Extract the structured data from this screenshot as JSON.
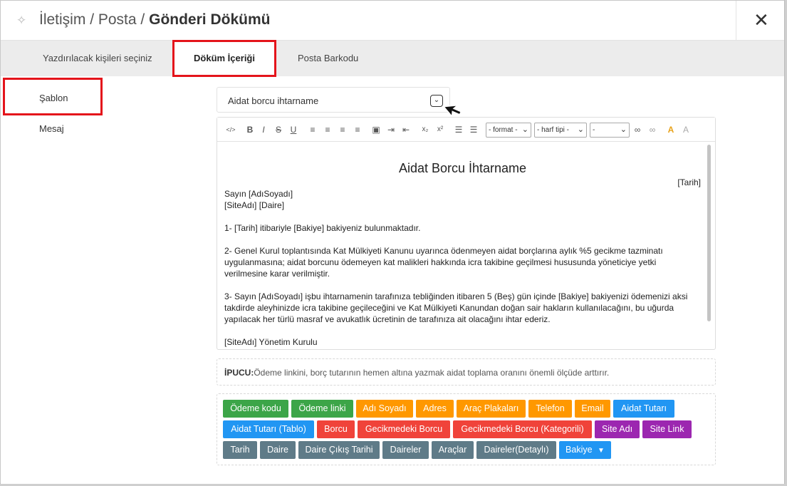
{
  "header": {
    "breadcrumb_1": "İletişim",
    "sep_1": "/",
    "breadcrumb_2": "Posta",
    "sep_2": "/",
    "page_title": "Gönderi Dökümü",
    "close_icon": "close-icon",
    "pin_icon": "pin-icon"
  },
  "tabs": [
    {
      "label": "Yazdırılacak kişileri seçiniz"
    },
    {
      "label": "Döküm İçeriği"
    },
    {
      "label": "Posta Barkodu"
    }
  ],
  "sidebar": {
    "items": [
      {
        "label": "Şablon"
      },
      {
        "label": "Mesaj"
      }
    ]
  },
  "template_select": {
    "value": "Aidat borcu ihtarname"
  },
  "toolbar": {
    "format_label": "- format -",
    "font_label": "- harf tipi -",
    "size_label": "-"
  },
  "document": {
    "title": "Aidat Borcu İhtarname",
    "date_tag": "[Tarih]",
    "greeting_1": "Sayın [AdıSoyadı]",
    "greeting_2": "[SiteAdı] [Daire]",
    "para_1": "1- [Tarih] itibariyle [Bakiye] bakiyeniz bulunmaktadır.",
    "para_2": "2- Genel Kurul toplantısında Kat Mülkiyeti Kanunu uyarınca ödenmeyen aidat borçlarına aylık %5 gecikme tazminatı uygulanmasına; aidat borcunu ödemeyen kat malikleri hakkında icra takibine geçilmesi hususunda yöneticiye yetki verilmesine karar verilmiştir.",
    "para_3": "3- Sayın [AdıSoyadı] işbu ihtarnamenin tarafınıza tebliğinden itibaren 5 (Beş) gün içinde [Bakiye] bakiyenizi ödemenizi aksi takdirde aleyhinizde icra takibine geçileceğini ve Kat Mülkiyeti Kanundan doğan sair hakların kullanılacağını, bu uğurda yapılacak her türlü masraf ve avukatlık ücretinin de tarafınıza ait olacağını ihtar ederiz.",
    "signature": "[SiteAdı] Yönetim Kurulu"
  },
  "tip": {
    "label": "İPUCU:",
    "text": "Ödeme linkini, borç tutarının hemen altına yazmak aidat toplama oranını önemli ölçüde arttırır."
  },
  "buttons": {
    "b1": "Ödeme kodu",
    "b2": "Ödeme linki",
    "b3": "Adı Soyadı",
    "b4": "Adres",
    "b5": "Araç Plakaları",
    "b6": "Telefon",
    "b7": "Email",
    "b8": "Aidat Tutarı",
    "b9": "Aidat Tutarı (Tablo)",
    "b10": "Borcu",
    "b11": "Gecikmedeki Borcu",
    "b12": "Gecikmedeki Borcu (Kategorili)",
    "b13": "Site Adı",
    "b14": "Site Link",
    "b15": "Tarih",
    "b16": "Daire",
    "b17": "Daire Çıkış Tarihi",
    "b18": "Daireler",
    "b19": "Araçlar",
    "b20": "Daireler(Detaylı)",
    "b21": "Bakiye",
    "b21_caret": "▼"
  },
  "colors": {
    "green": "#3ca548",
    "orange": "#ff9800",
    "blue": "#2196f3",
    "red": "#f0433a",
    "purple": "#9c27b0",
    "slate": "#5f7b88",
    "highlight": "#e4141b"
  }
}
